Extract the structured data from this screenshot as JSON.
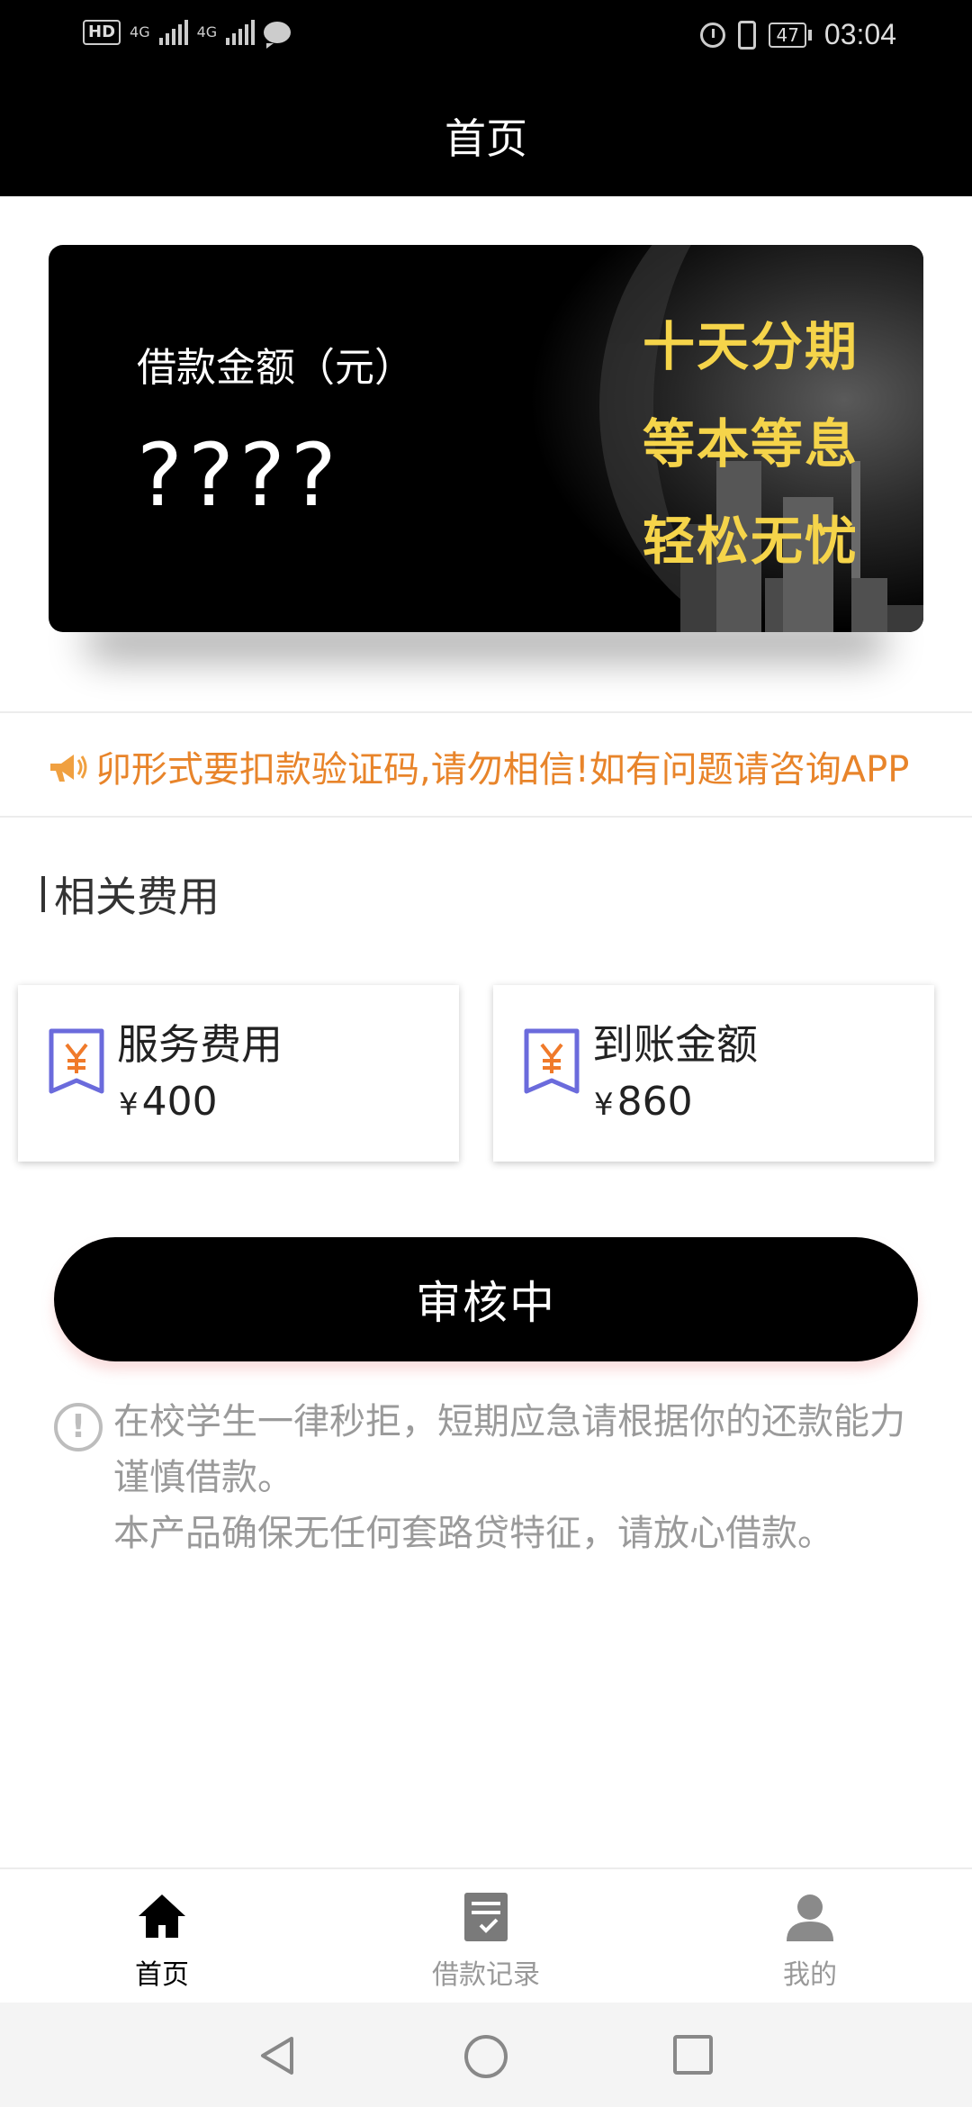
{
  "status_bar": {
    "network_left": "HD",
    "sim1_label": "4G",
    "sim2_label": "4G",
    "battery": "47",
    "time": "03:04"
  },
  "header": {
    "title": "首页"
  },
  "banner": {
    "label": "借款金额（元）",
    "amount": "????",
    "slogans": [
      "十天分期",
      "等本等息",
      "轻松无忧"
    ],
    "slogan_color": "#f5d44a"
  },
  "notice": {
    "text": "卯形式要扣款验证码,请勿相信!如有问题请咨询APP",
    "color": "#e8842a"
  },
  "fees": {
    "section_title": "相关费用",
    "cards": [
      {
        "title": "服务费用",
        "currency": "¥",
        "amount": "400"
      },
      {
        "title": "到账金额",
        "currency": "¥",
        "amount": "860"
      }
    ]
  },
  "status_button": {
    "label": "审核中"
  },
  "tips": {
    "lines": [
      "在校学生一律秒拒，短期应急请根据你的还款能力谨慎借款。",
      "本产品确保无任何套路贷特征，请放心借款。"
    ]
  },
  "bottom_nav": {
    "items": [
      {
        "label": "首页",
        "icon": "home-icon",
        "active": true
      },
      {
        "label": "借款记录",
        "icon": "record-icon",
        "active": false
      },
      {
        "label": "我的",
        "icon": "user-icon",
        "active": false
      }
    ]
  }
}
